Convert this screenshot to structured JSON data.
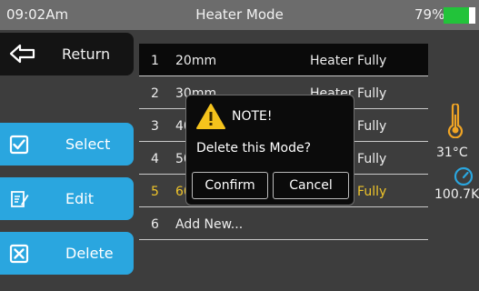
{
  "status": {
    "time": "09:02Am",
    "title": "Heater Mode",
    "battery_percent": "79%",
    "battery_level": 0.79
  },
  "sidebar": {
    "return_label": "Return",
    "select_label": "Select",
    "edit_label": "Edit",
    "delete_label": "Delete"
  },
  "modes": [
    {
      "num": "1",
      "name": "20mm",
      "type": "Heater Fully"
    },
    {
      "num": "2",
      "name": "30mm",
      "type": "Heater Fully"
    },
    {
      "num": "3",
      "name": "40mm",
      "type": "Heater Fully"
    },
    {
      "num": "4",
      "name": "50mm",
      "type": "Heater Fully"
    },
    {
      "num": "5",
      "name": "60mm",
      "type": "Heater Fully"
    },
    {
      "num": "6",
      "name": "Add New...",
      "type": ""
    }
  ],
  "readings": {
    "temperature": "31°C",
    "pressure": "100.7K"
  },
  "dialog": {
    "title": "NOTE!",
    "message": "Delete this Mode?",
    "confirm_label": "Confirm",
    "cancel_label": "Cancel"
  },
  "colors": {
    "accent_blue": "#2aa6df",
    "highlight_yellow": "#f0c52a",
    "battery_green": "#22c33a"
  }
}
